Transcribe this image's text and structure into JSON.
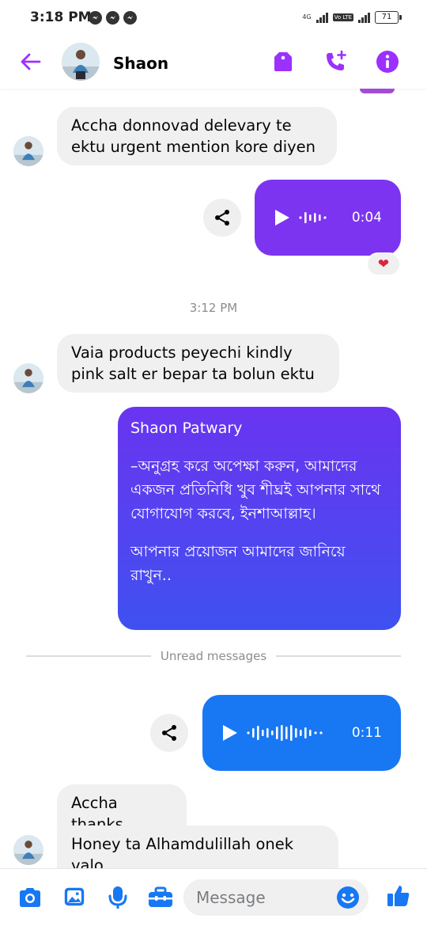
{
  "status": {
    "time": "3:18 PM",
    "network_label": "4G",
    "volte_label": "Vo LTE",
    "battery": "71"
  },
  "header": {
    "contact_name": "Shaon"
  },
  "messages": {
    "in1_text": "Accha donnovad delevary te ektu urgent mention kore diyen",
    "voice1_duration": "0:04",
    "reaction1": "❤",
    "time_divider": "3:12 PM",
    "in2_text": "Vaia products peyechi kindly pink salt er bepar ta bolun ektu",
    "out_sender": "Shaon Patwary",
    "out_line1": "–অনুগ্রহ করে অপেক্ষা করুন, আমাদের একজন প্রতিনিধি খুব শীঘ্রই আপনার সাথে যোগাযোগ করবে, ইনশাআল্লাহ।",
    "out_line2": "আপনার প্রয়োজন আমাদের জানিয়ে রাখুন..",
    "unread_label": "Unread messages",
    "voice2_duration": "0:11",
    "in3_text": "Accha thanks",
    "in4_text": "Honey ta Alhamdulillah onek valo"
  },
  "composer": {
    "placeholder": "Message"
  },
  "colors": {
    "accent_purple": "#9b30ff",
    "voice1_bg": "#7d34f0",
    "voice2_bg": "#1877f2",
    "incoming_bg": "#f0f0f0",
    "composer_blue": "#1877f2"
  },
  "icons": {
    "back": "arrow-left-icon",
    "tag": "tag-icon",
    "add_call": "phone-plus-icon",
    "info": "info-icon",
    "share": "share-icon",
    "play": "play-icon",
    "camera": "camera-icon",
    "gallery": "image-icon",
    "mic": "microphone-icon",
    "tools": "toolbox-icon",
    "emoji": "smiley-icon",
    "like": "thumbs-up-icon"
  }
}
